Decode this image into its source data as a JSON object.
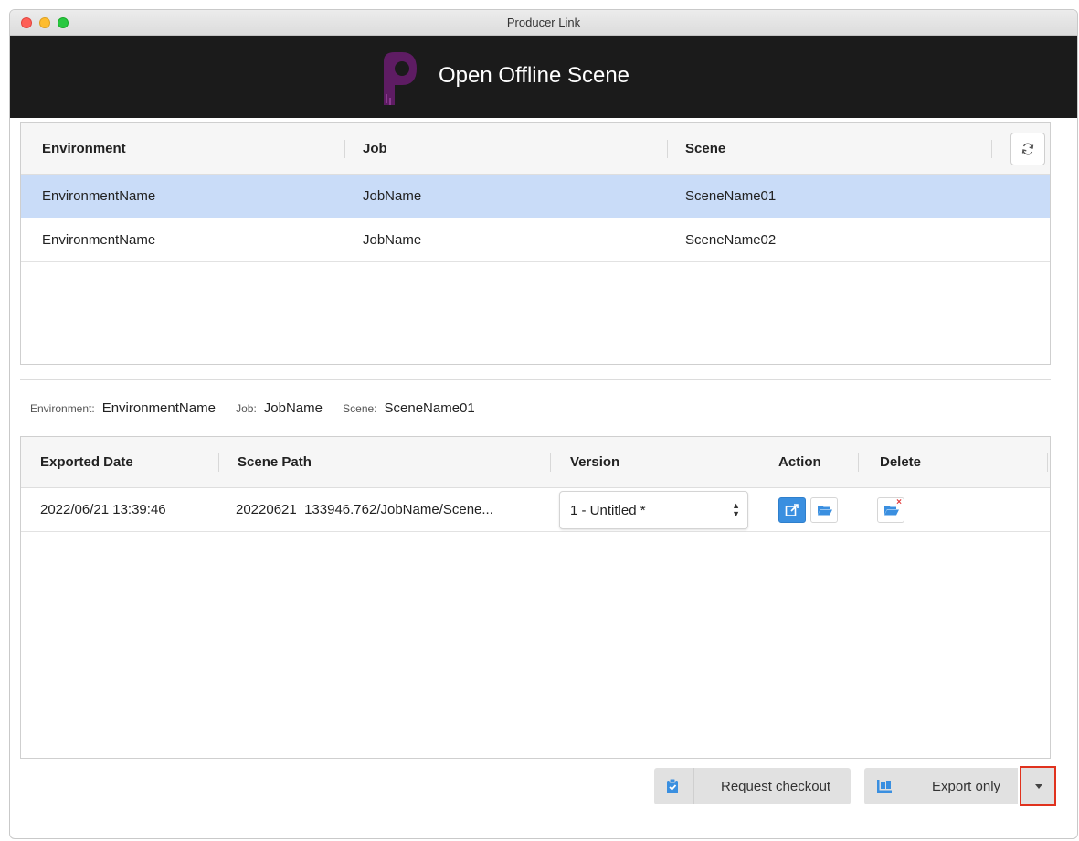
{
  "window": {
    "title": "Producer Link"
  },
  "banner": {
    "title": "Open Offline Scene"
  },
  "scenes_table": {
    "headers": {
      "environment": "Environment",
      "job": "Job",
      "scene": "Scene"
    },
    "rows": [
      {
        "environment": "EnvironmentName",
        "job": "JobName",
        "scene": "SceneName01",
        "selected": true
      },
      {
        "environment": "EnvironmentName",
        "job": "JobName",
        "scene": "SceneName02",
        "selected": false
      }
    ]
  },
  "selection_info": {
    "environment_label": "Environment:",
    "environment_value": "EnvironmentName",
    "job_label": "Job:",
    "job_value": "JobName",
    "scene_label": "Scene:",
    "scene_value": "SceneName01"
  },
  "exports_table": {
    "headers": {
      "exported_date": "Exported Date",
      "scene_path": "Scene Path",
      "version": "Version",
      "action": "Action",
      "delete": "Delete"
    },
    "rows": [
      {
        "exported_date": "2022/06/21 13:39:46",
        "scene_path": "20220621_133946.762/JobName/Scene...",
        "version": "1 - Untitled *"
      }
    ]
  },
  "footer": {
    "request_checkout_label": "Request checkout",
    "export_only_label": "Export only"
  },
  "colors": {
    "selected_row": "#c9dcf8",
    "banner_bg": "#1b1b1b",
    "logo_purple": "#5e1c63",
    "primary_button": "#3a8fe0",
    "highlight_outline": "#e0321e"
  },
  "icons": [
    "refresh-icon",
    "edit-external-icon",
    "folder-open-icon",
    "folder-delete-icon",
    "clipboard-check-icon",
    "export-icon",
    "caret-down-icon"
  ]
}
